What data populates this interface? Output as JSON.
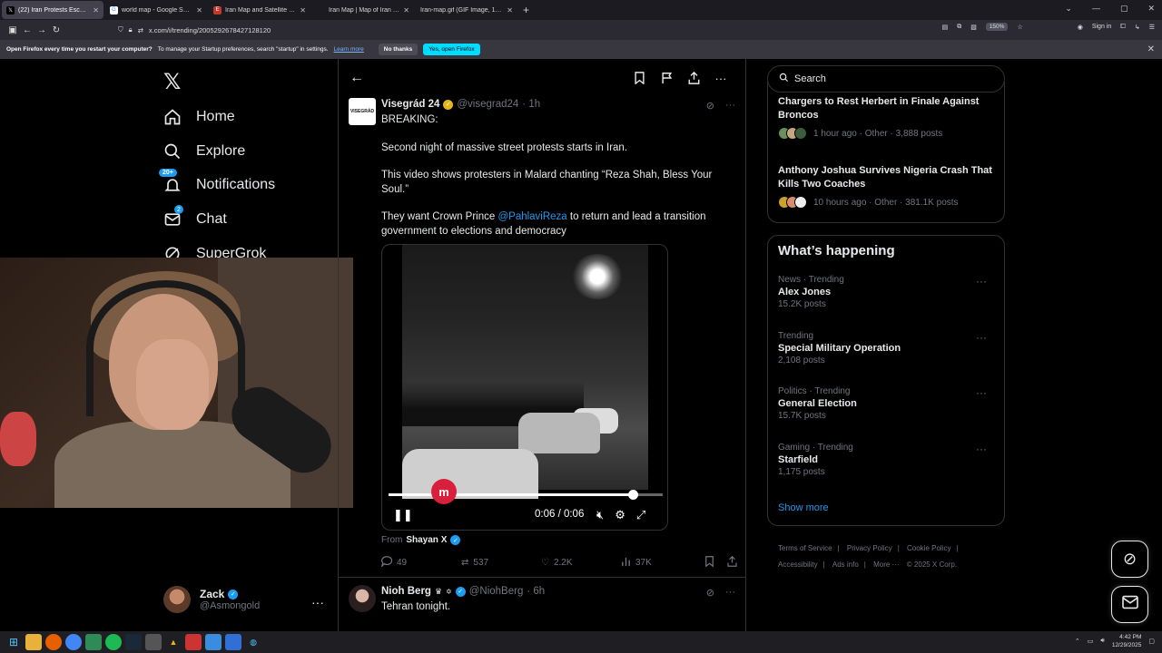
{
  "browser": {
    "tabs": [
      {
        "title": "(22) Iran Protests Escalate as R",
        "favicon": "x-icon",
        "active": true
      },
      {
        "title": "world map - Google Search",
        "favicon": "google-icon"
      },
      {
        "title": "Iran Map and Satellite Image",
        "favicon": "map-icon"
      },
      {
        "title": "Iran Map | Map of Iran | Collecti",
        "favicon": "map-icon"
      },
      {
        "title": "Iran-map.gif (GIF Image, 1000 × 91",
        "favicon": "image-icon"
      }
    ],
    "url": "x.com/i/trending/2005292678427128120",
    "zoom": "150%",
    "sign_in": "Sign in"
  },
  "notification_bar": {
    "bold": "Open Firefox every time you restart your computer?",
    "text": "To manage your Startup preferences, search \"startup\" in settings.",
    "link": "Learn more",
    "no": "No thanks",
    "yes": "Yes, open Firefox"
  },
  "left_nav": {
    "items": [
      {
        "label": "Home",
        "icon": "home-icon"
      },
      {
        "label": "Explore",
        "icon": "search-icon"
      },
      {
        "label": "Notifications",
        "icon": "bell-icon",
        "badge": "20+"
      },
      {
        "label": "Chat",
        "icon": "mail-icon",
        "badge": "2"
      },
      {
        "label": "SuperGrok",
        "icon": "grok-icon"
      }
    ],
    "account": {
      "name": "Zack",
      "handle": "@Asmongold"
    }
  },
  "post": {
    "author": "Visegrád 24",
    "handle": "@visegrad24",
    "time": "· 1h",
    "avatar_text": "VISEGRÁD",
    "lines": {
      "l1": "BREAKING:",
      "l2": "Second night of massive street protests starts in Iran.",
      "l3": "This video shows protesters in Malard chanting “Reza Shah, Bless Your Soul.”",
      "l4a": "They want Crown Prince ",
      "mention": "@PahlaviReza",
      "l4b": " to return and lead a transition government to elections and democracy"
    },
    "video": {
      "time": "0:06 / 0:06",
      "progress": 0.89,
      "watermark": "m"
    },
    "from_label": "From",
    "from_name": "Shayan X",
    "stats": {
      "replies": "49",
      "reposts": "537",
      "likes": "2.2K",
      "views": "37K"
    }
  },
  "post2": {
    "author": "Nioh Berg",
    "handle": "@NiohBerg",
    "time": "· 6h",
    "text": "Tehran tonight."
  },
  "right": {
    "search_placeholder": "Search",
    "news": [
      {
        "title": "Chargers to Rest Herbert in Finale Against Broncos",
        "meta": "1 hour ago · Other · 3,888 posts"
      },
      {
        "title": "Anthony Joshua Survives Nigeria Crash That Kills Two Coaches",
        "meta": "10 hours ago · Other · 381.1K posts"
      }
    ],
    "whats_happening": "What’s happening",
    "trends": [
      {
        "cat": "News · Trending",
        "title": "Alex Jones",
        "posts": "15.2K posts"
      },
      {
        "cat": "Trending",
        "title": "Special Military Operation",
        "posts": "2,108 posts"
      },
      {
        "cat": "Politics · Trending",
        "title": "General Election",
        "posts": "15.7K posts"
      },
      {
        "cat": "Gaming · Trending",
        "title": "Starfield",
        "posts": "1,175 posts"
      }
    ],
    "show_more": "Show more",
    "footer": {
      "terms": "Terms of Service",
      "privacy": "Privacy Policy",
      "cookie": "Cookie Policy",
      "access": "Accessibility",
      "ads": "Ads info",
      "more": "More ···",
      "copy": "© 2025 X Corp."
    }
  },
  "taskbar": {
    "time": "4:42 PM",
    "date": "12/29/2025"
  },
  "colors": {
    "accent": "#1d9bf0",
    "verified_gold": "#e2b719",
    "bg": "#000000",
    "border": "#2f3336"
  }
}
